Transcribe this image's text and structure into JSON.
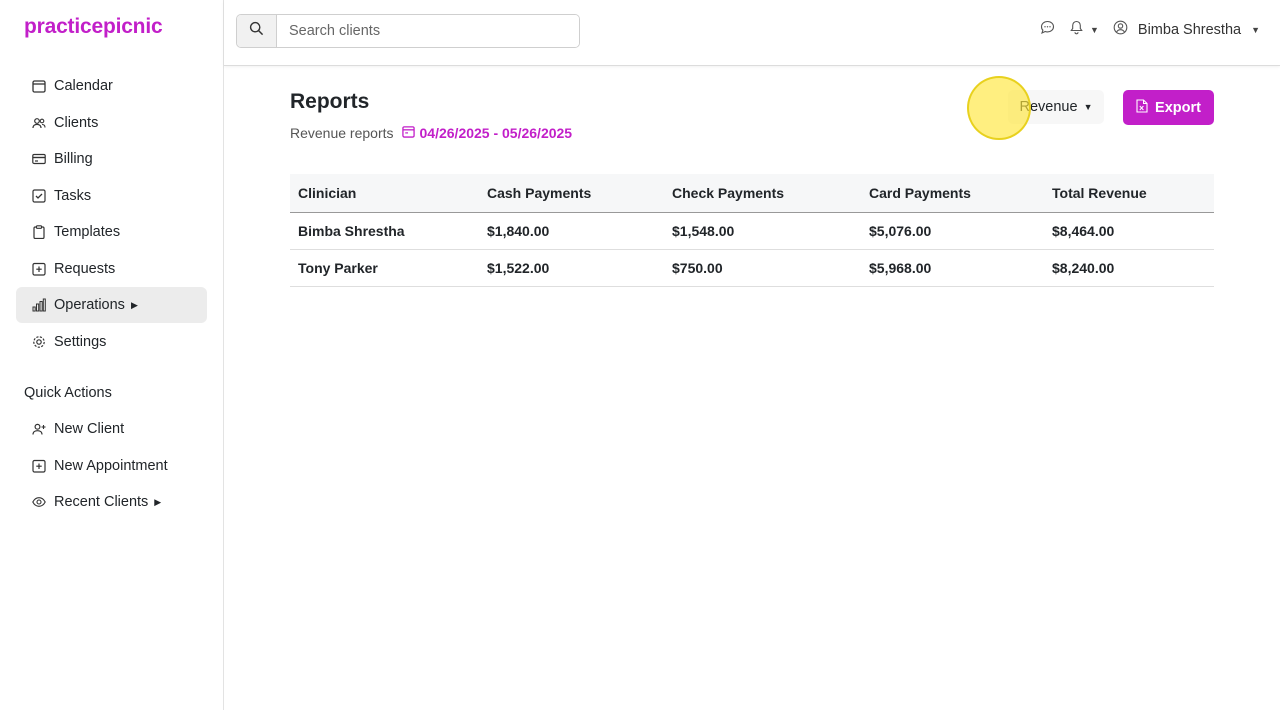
{
  "brand": {
    "name": "practicepicnic",
    "accent": "#c21fc9"
  },
  "sidebar": {
    "items": [
      {
        "label": "Calendar",
        "icon": "calendar-icon"
      },
      {
        "label": "Clients",
        "icon": "users-icon"
      },
      {
        "label": "Billing",
        "icon": "credit-card-icon"
      },
      {
        "label": "Tasks",
        "icon": "checkbox-icon"
      },
      {
        "label": "Templates",
        "icon": "clipboard-icon"
      },
      {
        "label": "Requests",
        "icon": "plus-square-icon"
      },
      {
        "label": "Operations",
        "icon": "bar-chart-icon",
        "active": true
      },
      {
        "label": "Settings",
        "icon": "gear-icon"
      }
    ],
    "quick_actions_title": "Quick Actions",
    "quick_actions": [
      {
        "label": "New Client",
        "icon": "user-plus-icon"
      },
      {
        "label": "New Appointment",
        "icon": "calendar-plus-icon"
      },
      {
        "label": "Recent Clients",
        "icon": "eye-icon"
      }
    ]
  },
  "search": {
    "placeholder": "Search clients",
    "value": ""
  },
  "user": {
    "name": "Bimba Shrestha"
  },
  "reports": {
    "title": "Reports",
    "subtitle": "Revenue reports",
    "date_range": "04/26/2025 - 05/26/2025",
    "report_type": "Revenue",
    "export_label": "Export",
    "columns": [
      "Clinician",
      "Cash Payments",
      "Check Payments",
      "Card Payments",
      "Total Revenue"
    ],
    "rows": [
      [
        "Bimba Shrestha",
        "$1,840.00",
        "$1,548.00",
        "$5,076.00",
        "$8,464.00"
      ],
      [
        "Tony Parker",
        "$1,522.00",
        "$750.00",
        "$5,968.00",
        "$8,240.00"
      ]
    ]
  }
}
